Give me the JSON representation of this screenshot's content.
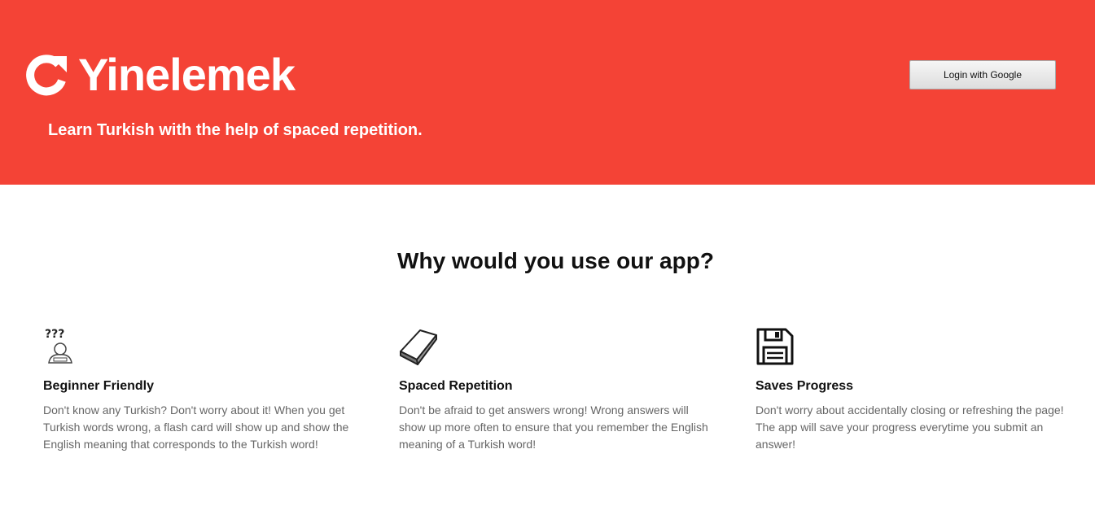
{
  "header": {
    "app_name": "Yinelemek",
    "tagline": "Learn Turkish with the help of spaced repetition.",
    "login_label": "Login with Google",
    "logo_icon": "refresh-icon"
  },
  "main": {
    "title": "Why would you use our app?",
    "features": [
      {
        "icon": "confused-person-icon",
        "title": "Beginner Friendly",
        "description": "Don't know any Turkish? Don't worry about it! When you get Turkish words wrong, a flash card will show up and show the English meaning that corresponds to the Turkish word!"
      },
      {
        "icon": "book-icon",
        "title": "Spaced Repetition",
        "description": "Don't be afraid to get answers wrong! Wrong answers will show up more often to ensure that you remember the English meaning of a Turkish word!"
      },
      {
        "icon": "floppy-disk-icon",
        "title": "Saves Progress",
        "description": "Don't worry about accidentally closing or refreshing the page! The app will save your progress everytime you submit an answer!"
      }
    ]
  },
  "colors": {
    "brand": "#f44336",
    "heading": "#111111",
    "body_text": "#666666"
  }
}
